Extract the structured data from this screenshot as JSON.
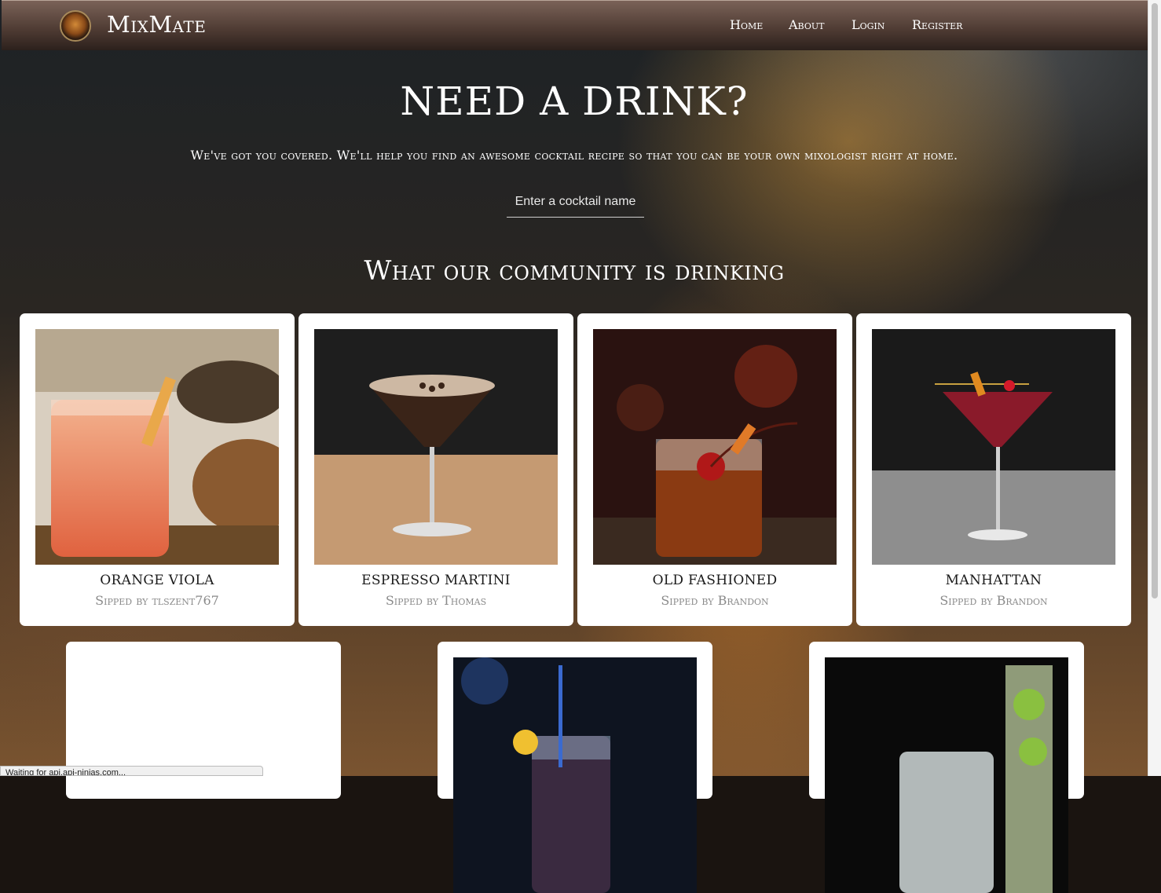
{
  "navbar": {
    "brand": "MixMate",
    "links": [
      "Home",
      "About",
      "Login",
      "Register"
    ]
  },
  "hero": {
    "title": "Need a drink?",
    "subtitle": "We've got you covered. We'll help you find an awesome cocktail recipe so that you can be your own mixologist right at home.",
    "search_placeholder": "Enter a cocktail name"
  },
  "community": {
    "heading": "What our community is drinking",
    "cards": [
      {
        "name": "Orange Viola",
        "by": "Sipped by tlszent767"
      },
      {
        "name": "Espresso Martini",
        "by": "Sipped by Thomas"
      },
      {
        "name": "Old Fashioned",
        "by": "Sipped by Brandon"
      },
      {
        "name": "Manhattan",
        "by": "Sipped by Brandon"
      }
    ]
  },
  "status_bar": "Waiting for api.api-ninjas.com..."
}
